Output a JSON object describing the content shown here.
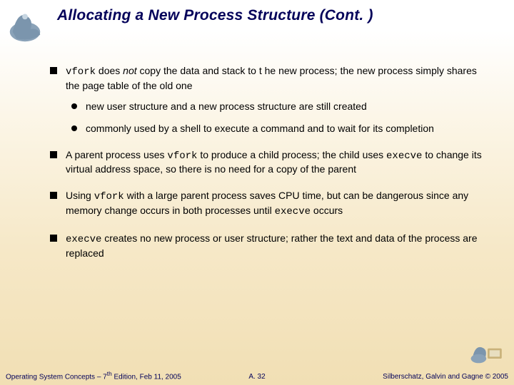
{
  "title": "Allocating a New Process Structure (Cont. )",
  "bullets": {
    "b1_pre": "vfork",
    "b1_mid_a": " does ",
    "b1_italic": "not",
    "b1_mid_b": " copy the data and stack to t he new process; the new process simply shares the page table of the old one",
    "b1_sub1": "new user structure and a new process structure are still created",
    "b1_sub2": "commonly used by a shell to execute a command and to wait for its completion",
    "b2_a": "A parent process uses ",
    "b2_code1": "vfork",
    "b2_b": " to produce a child process; the child uses ",
    "b2_code2": "execve",
    "b2_c": " to change its virtual address space, so there is no need for a copy of the parent",
    "b3_a": "Using ",
    "b3_code1": "vfork",
    "b3_b": " with a large parent process saves CPU time, but can be dangerous since any memory change occurs in both processes until ",
    "b3_code2": "execve",
    "b3_c": " occurs",
    "b4_code": "execve",
    "b4_a": " creates no new process or user structure; rather the text and data of the process are replaced"
  },
  "footer": {
    "left_a": "Operating System Concepts – 7",
    "left_sup": "th",
    "left_b": " Edition, Feb 11, 2005",
    "center": "A. 32",
    "right_a": "Silberschatz, Galvin and Gagne ",
    "right_b": "© 2005"
  }
}
